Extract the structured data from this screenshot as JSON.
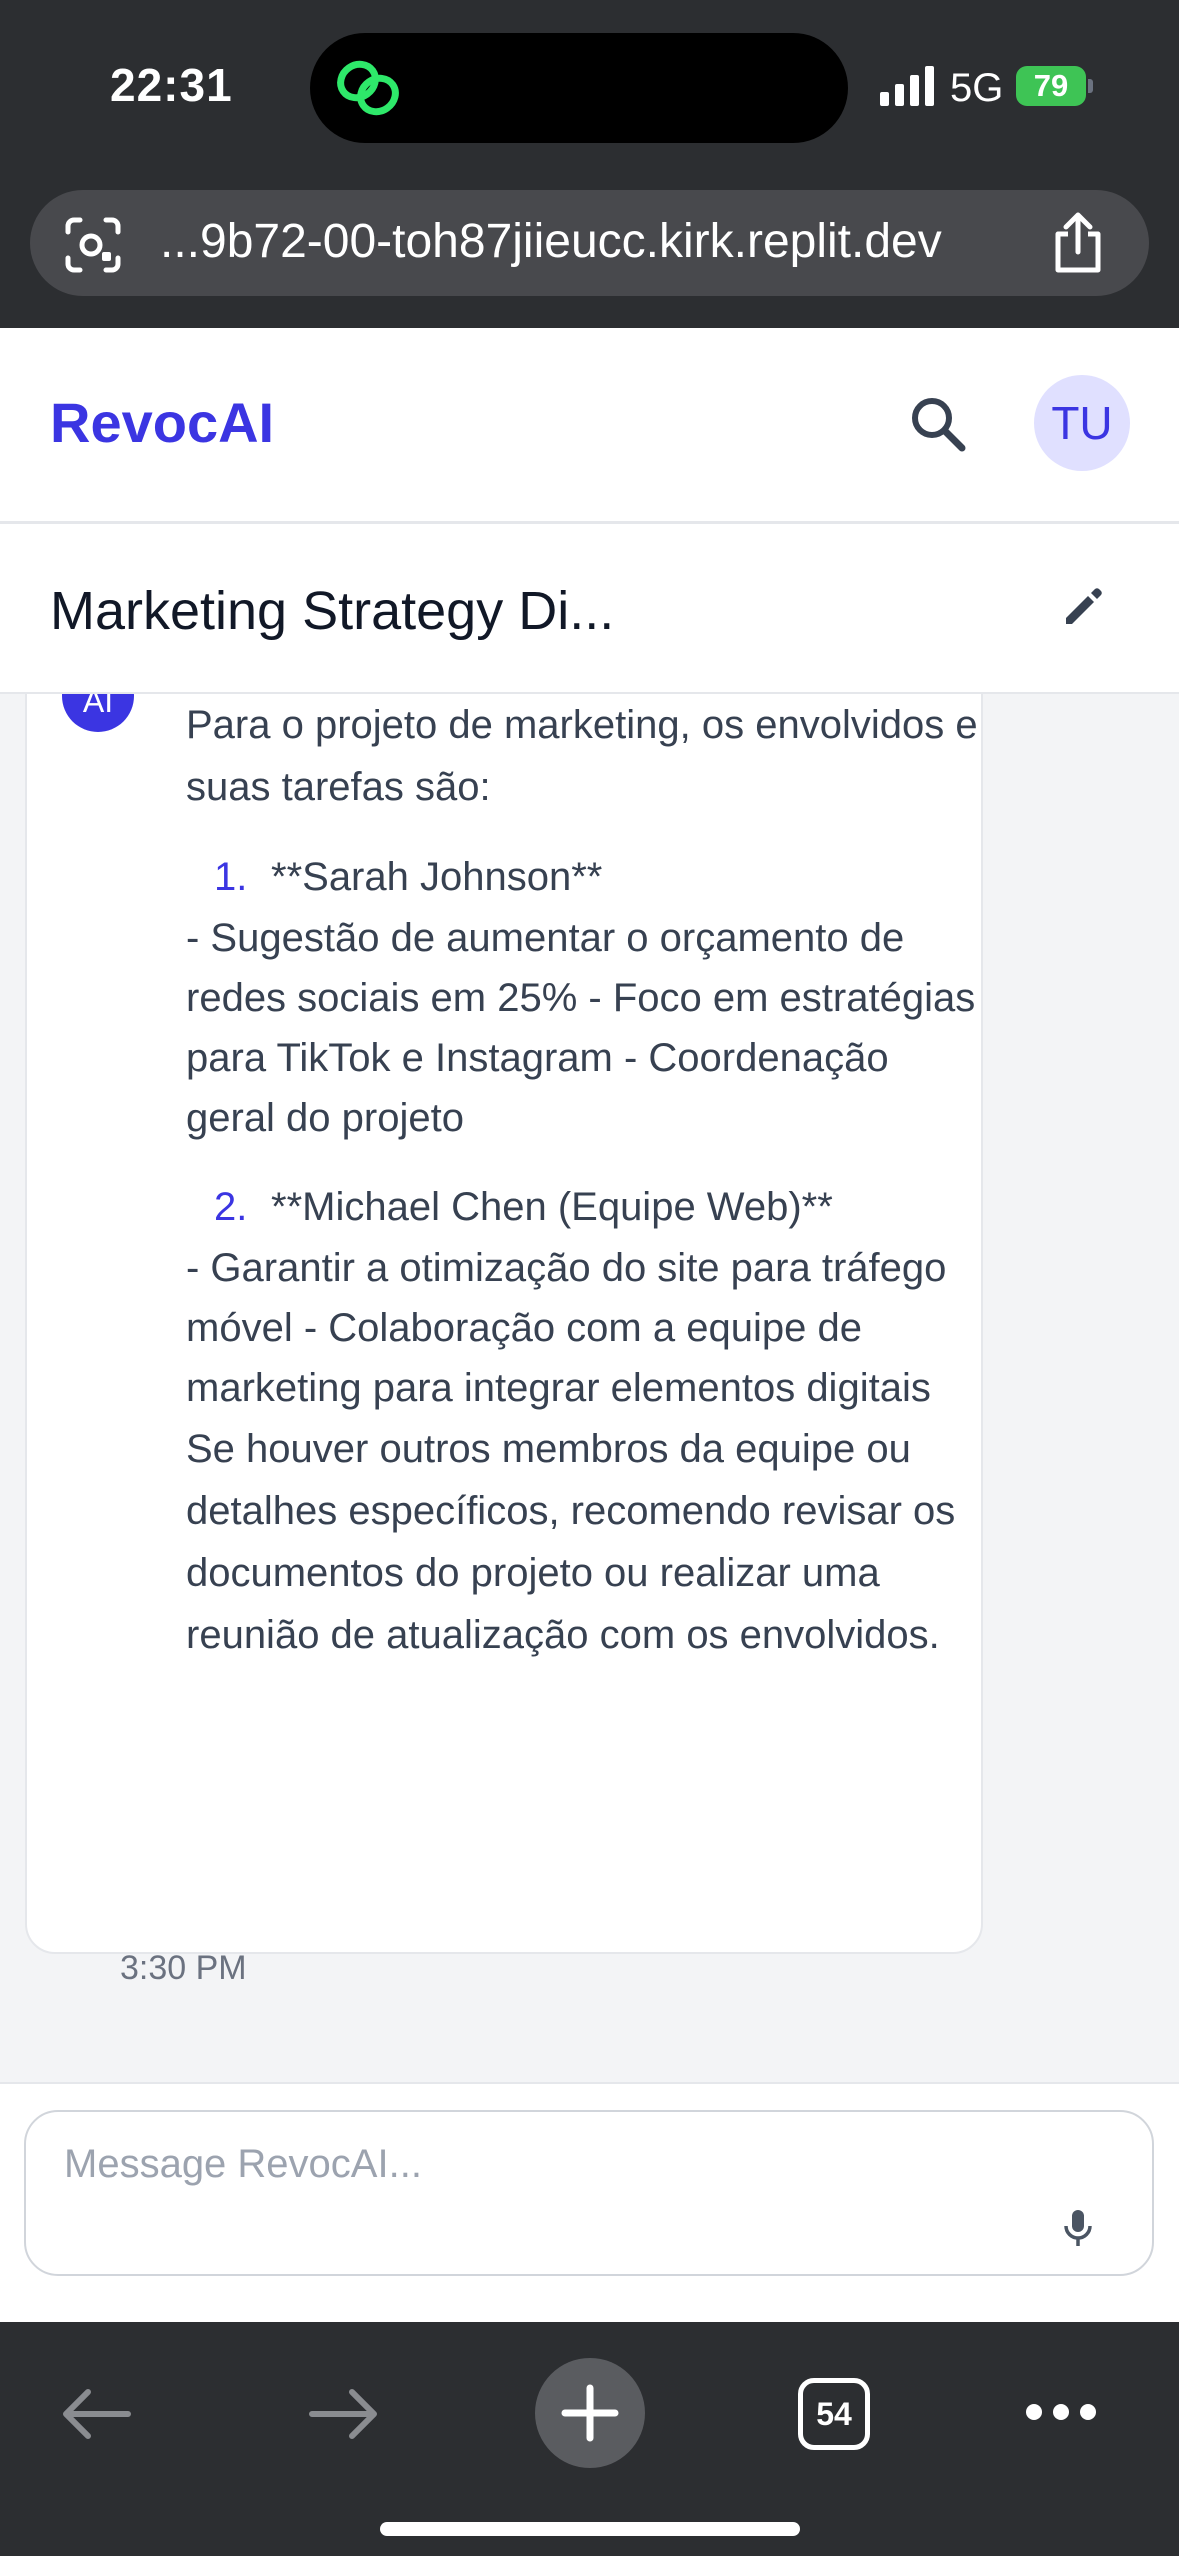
{
  "status_bar": {
    "time": "22:31",
    "network": "5G",
    "battery": "79"
  },
  "browser": {
    "url": "...9b72-00-toh87jiieucc.kirk.replit.dev",
    "tab_count": "54"
  },
  "app": {
    "logo": "RevocAI",
    "avatar_initials": "TU",
    "conversation_title": "Marketing Strategy Di..."
  },
  "message": {
    "sender_badge": "AI",
    "intro": "Para o projeto de marketing, os envolvidos e suas tarefas são:",
    "items": [
      {
        "number": "1.",
        "name": "**Sarah Johnson**",
        "description": "- Sugestão de aumentar o orçamento de redes sociais em 25% - Foco em estratégias para TikTok e Instagram - Coordenação geral do projeto"
      },
      {
        "number": "2.",
        "name": "**Michael Chen (Equipe Web)**",
        "description": "- Garantir a otimização do site para tráfego móvel - Colaboração com a equipe de marketing para integrar elementos digitais"
      }
    ],
    "closing": "Se houver outros membros da equipe ou detalhes específicos, recomendo revisar os documentos do projeto ou realizar uma reunião de atualização com os envolvidos.",
    "timestamp": "3:30 PM"
  },
  "composer": {
    "placeholder": "Message RevocAI..."
  },
  "colors": {
    "accent": "#3b35e2",
    "chrome": "#2c2e31",
    "battery": "#3ec455"
  }
}
